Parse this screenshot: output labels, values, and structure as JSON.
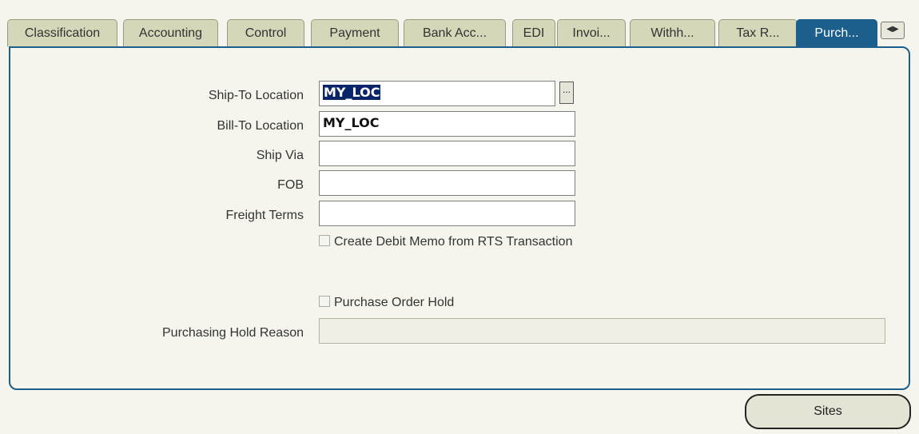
{
  "tabs": [
    {
      "label": "Classification"
    },
    {
      "label": "Accounting"
    },
    {
      "label": "Control"
    },
    {
      "label": "Payment"
    },
    {
      "label": "Bank Acc..."
    },
    {
      "label": "EDI"
    },
    {
      "label": "Invoi..."
    },
    {
      "label": "Withh..."
    },
    {
      "label": "Tax R..."
    },
    {
      "label": "Purch..."
    }
  ],
  "active_tab": "Purch...",
  "tab_scroll_icon": "left-right-arrows-icon",
  "form": {
    "ship_to_location": {
      "label": "Ship-To Location",
      "value": "MY_LOC"
    },
    "bill_to_location": {
      "label": "Bill-To Location",
      "value": "MY_LOC"
    },
    "ship_via": {
      "label": "Ship Via",
      "value": ""
    },
    "fob": {
      "label": "FOB",
      "value": ""
    },
    "freight_terms": {
      "label": "Freight Terms",
      "value": ""
    },
    "create_debit_memo": {
      "label": "Create Debit Memo from RTS Transaction",
      "checked": false
    },
    "purchase_order_hold": {
      "label": "Purchase Order Hold",
      "checked": false
    },
    "purchasing_hold_reason": {
      "label": "Purchasing Hold Reason",
      "value": ""
    }
  },
  "lov_button_label": "...",
  "buttons": {
    "sites": "Sites"
  },
  "colors": {
    "accent": "#1d5f8c",
    "selection": "#0a246a",
    "tab_inactive": "#d6d6b8",
    "background": "#f5f5ee"
  }
}
